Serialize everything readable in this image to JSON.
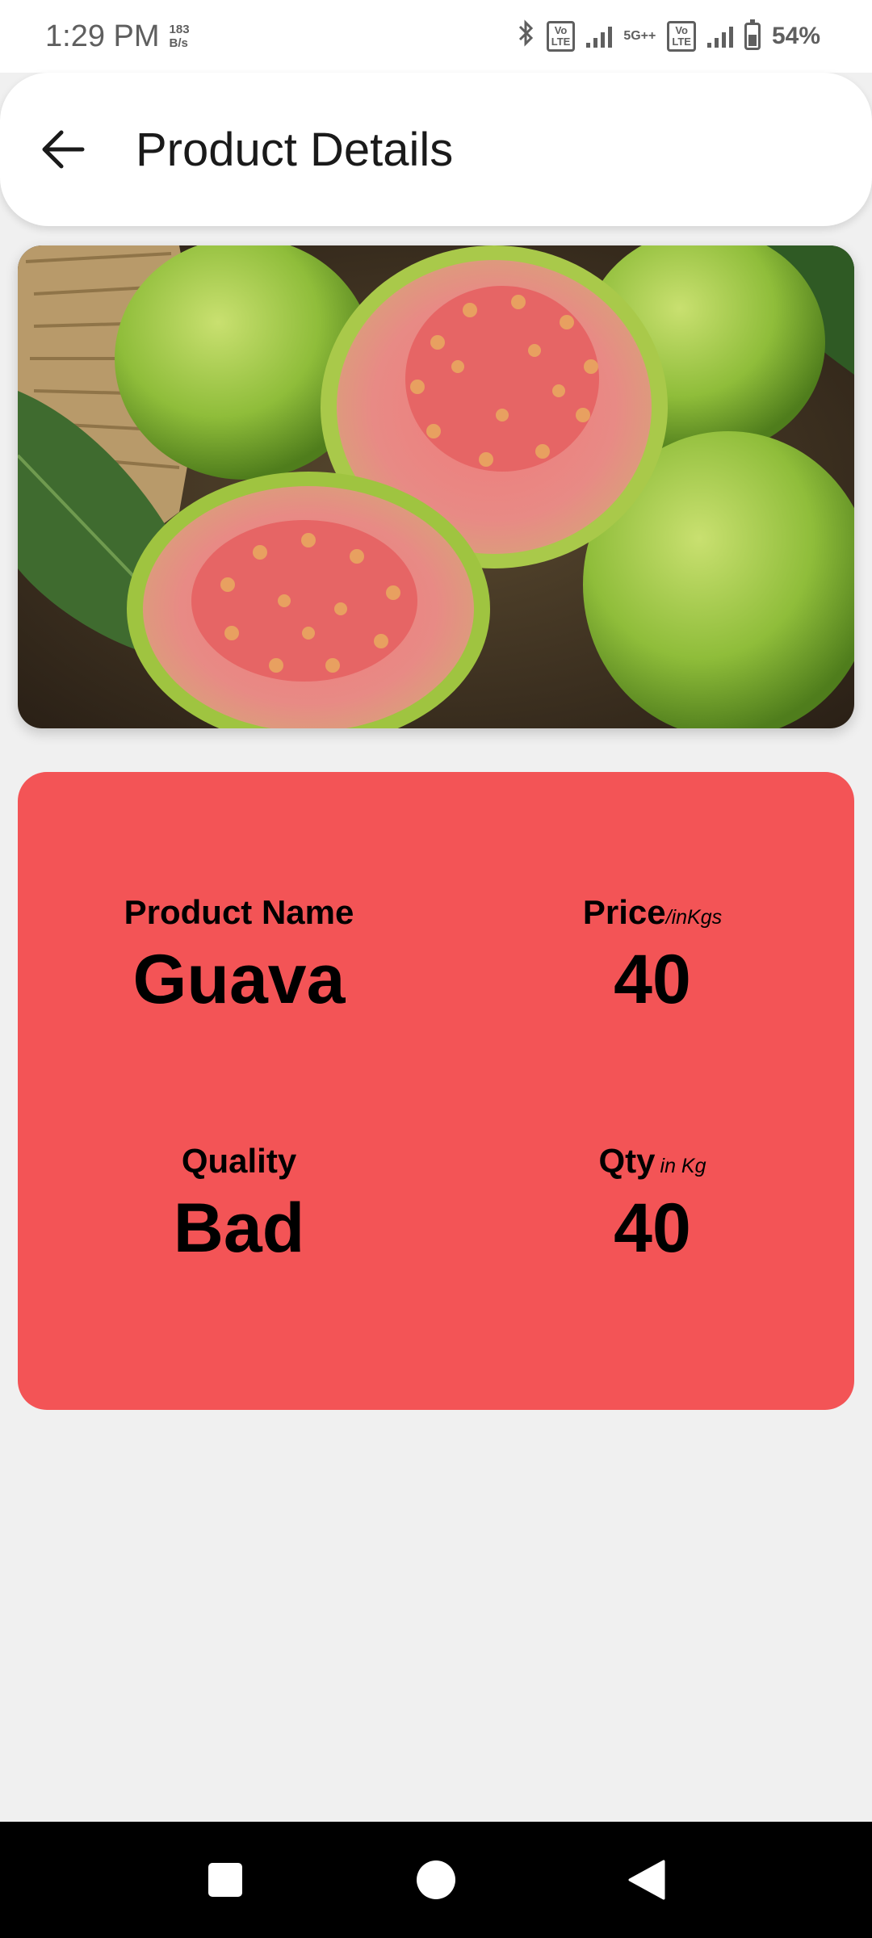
{
  "status_bar": {
    "time": "1:29 PM",
    "speed_value": "183",
    "speed_unit": "B/s",
    "volte1_top": "Vo",
    "volte1_bottom": "LTE",
    "network": "5G++",
    "volte2_top": "Vo",
    "volte2_bottom": "LTE",
    "battery": "54%",
    "icons": [
      "bluetooth-icon",
      "volte-icon",
      "signal-icon",
      "5g-icon",
      "volte-icon",
      "signal-icon",
      "battery-icon",
      "charging-icon"
    ]
  },
  "app_bar": {
    "title": "Product Details",
    "back_icon": "arrow-left-icon"
  },
  "product": {
    "image": "guava-photo",
    "name_label": "Product Name",
    "name_value": "Guava",
    "price_label": "Price",
    "price_unit": "/inKgs",
    "price_value": "40",
    "quality_label": "Quality",
    "quality_value": "Bad",
    "qty_label": "Qty",
    "qty_unit": "in Kg",
    "qty_value": "40"
  },
  "colors": {
    "card": "#f35456",
    "background": "#f0f0f0",
    "app_bar": "#ffffff"
  },
  "nav_bar": {
    "icons": [
      "recents-square-icon",
      "home-circle-icon",
      "back-triangle-icon"
    ]
  }
}
